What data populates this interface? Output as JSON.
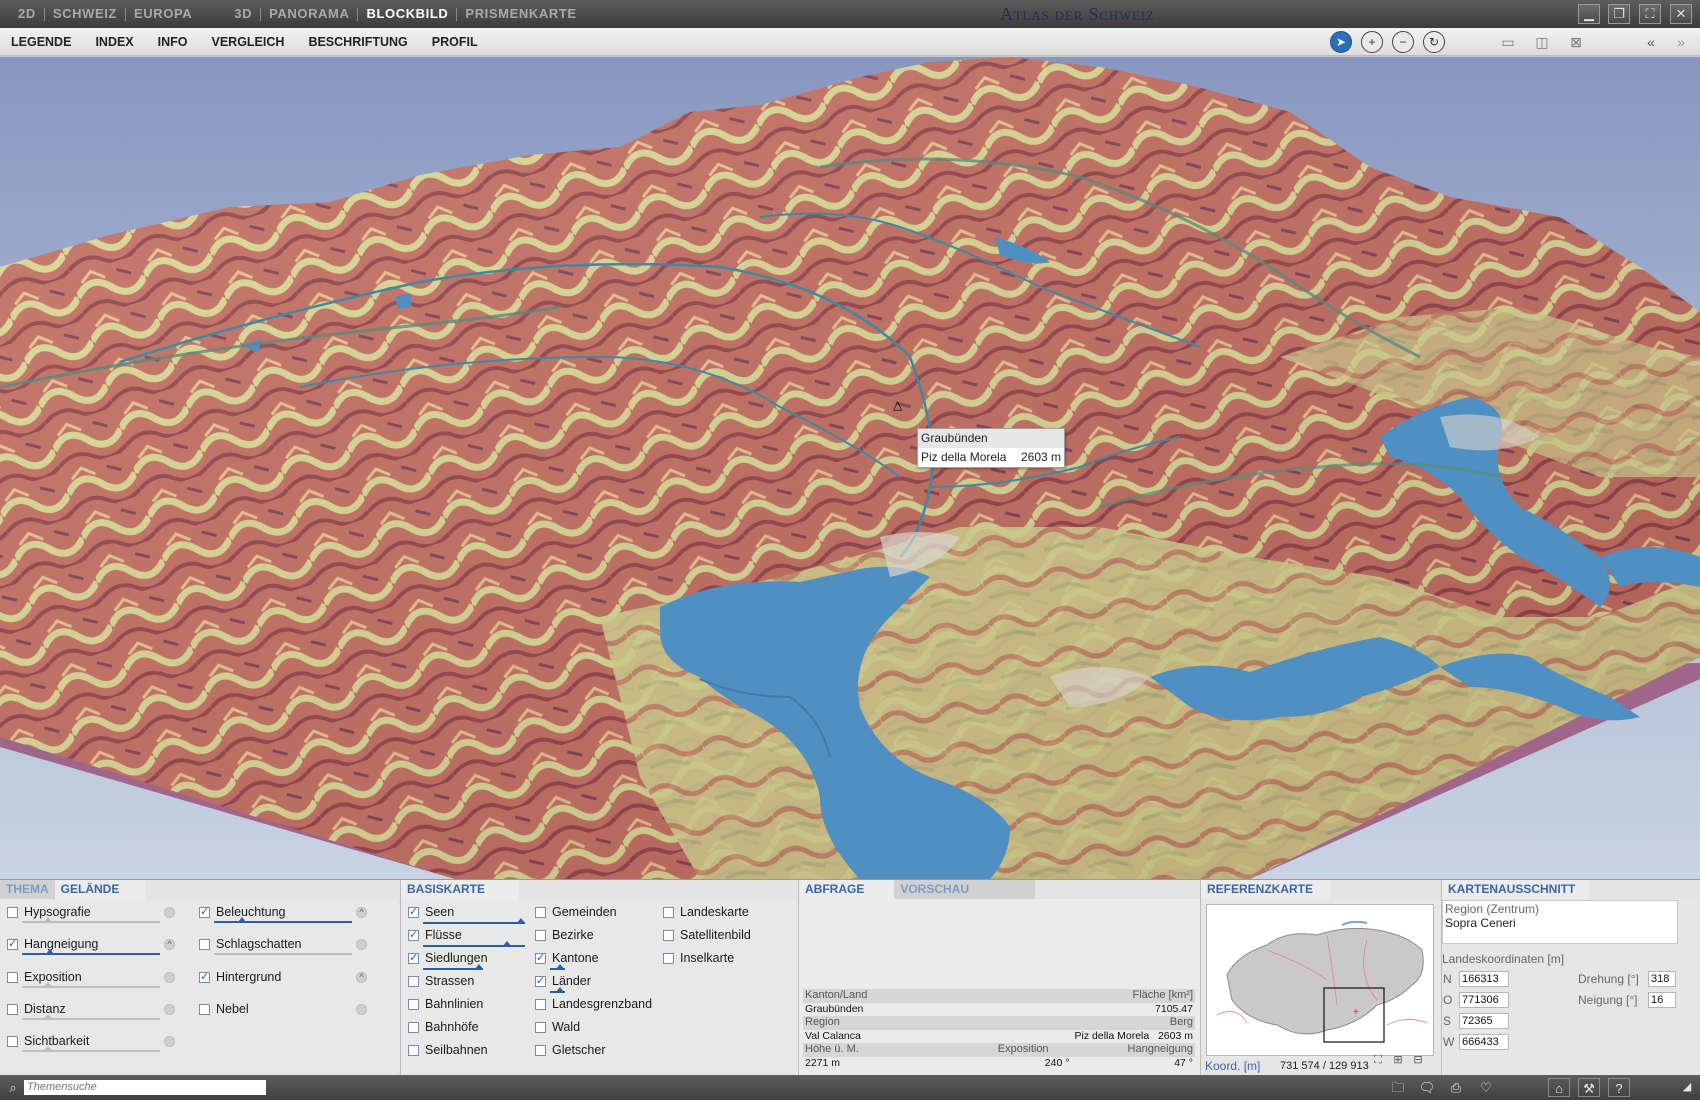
{
  "topbar": {
    "modes_2d": [
      "2D",
      "SCHWEIZ",
      "EUROPA"
    ],
    "modes_3d": [
      "3D",
      "PANORAMA",
      "BLOCKBILD",
      "PRISMENKARTE"
    ],
    "active_mode": "BLOCKBILD",
    "title": "Atlas der Schweiz",
    "window_controls": [
      "minimize-icon",
      "restore-icon",
      "fullscreen-icon",
      "close-icon"
    ]
  },
  "menu": {
    "items": [
      "LEGENDE",
      "INDEX",
      "INFO",
      "VERGLEICH",
      "BESCHRIFTUNG",
      "PROFIL"
    ],
    "tools": [
      "select-arrow-icon",
      "zoom-in-icon",
      "zoom-out-icon",
      "rotate-icon"
    ],
    "view_tools": [
      "horizontal-split-icon",
      "vertical-split-icon",
      "no-split-icon"
    ],
    "nav_tools": [
      "collapse-left-icon",
      "collapse-right-icon"
    ]
  },
  "map": {
    "tooltip": {
      "region": "Graubünden",
      "peak": "Piz della Morela",
      "height": "2603 m"
    },
    "summit_marker": "△"
  },
  "panel": {
    "tabs_left": [
      "THEMA",
      "GELÄNDE"
    ],
    "active_left_tab": "GELÄNDE",
    "gelaende_col1": [
      {
        "label": "Hypsografie",
        "checked": false
      },
      {
        "label": "Hangneigung",
        "checked": true
      },
      {
        "label": "Exposition",
        "checked": false
      },
      {
        "label": "Distanz",
        "checked": false
      },
      {
        "label": "Sichtbarkeit",
        "checked": false
      }
    ],
    "gelaende_col2": [
      {
        "label": "Beleuchtung",
        "checked": true
      },
      {
        "label": "Schlagschatten",
        "checked": false
      },
      {
        "label": "Hintergrund",
        "checked": true
      },
      {
        "label": "Nebel",
        "checked": false
      }
    ],
    "basiskarte_title": "BASISKARTE",
    "basis_col1": [
      {
        "label": "Seen",
        "checked": true
      },
      {
        "label": "Flüsse",
        "checked": true
      },
      {
        "label": "Siedlungen",
        "checked": true
      },
      {
        "label": "Strassen",
        "checked": false
      },
      {
        "label": "Bahnlinien",
        "checked": false
      },
      {
        "label": "Bahnhöfe",
        "checked": false
      },
      {
        "label": "Seilbahnen",
        "checked": false
      }
    ],
    "basis_col2": [
      {
        "label": "Gemeinden",
        "checked": false
      },
      {
        "label": "Bezirke",
        "checked": false
      },
      {
        "label": "Kantone",
        "checked": true
      },
      {
        "label": "Länder",
        "checked": true
      },
      {
        "label": "Landesgrenzband",
        "checked": false
      },
      {
        "label": "Wald",
        "checked": false
      },
      {
        "label": "Gletscher",
        "checked": false
      }
    ],
    "basis_col3": [
      {
        "label": "Landeskarte",
        "checked": false
      },
      {
        "label": "Satellitenbild",
        "checked": false
      },
      {
        "label": "Inselkarte",
        "checked": false
      }
    ],
    "abfrage_tabs": [
      "ABFRAGE",
      "VORSCHAU"
    ],
    "abfrage": {
      "h1": [
        "Kanton/Land",
        "Fläche [km²]"
      ],
      "v1": [
        "Graubünden",
        "7105.47"
      ],
      "h2": [
        "Region",
        "Berg"
      ],
      "v2": [
        "Val Calanca",
        "Piz della Morela   2603 m"
      ],
      "h3": [
        "Höhe ü. M.",
        "Exposition",
        "Hangneigung"
      ],
      "v3": [
        "2271 m",
        "240 °",
        "47 °"
      ]
    },
    "referenzkarte_title": "REFERENZKARTE",
    "koord_label": "Koord. [m]",
    "koord_value": "731 574 / 129 913",
    "kartenausschnitt_title": "KARTENAUSSCHNITT",
    "region_label": "Region (Zentrum)",
    "region_value": "Sopra Ceneri",
    "landeskoordinaten_label": "Landeskoordinaten [m]",
    "coords": [
      {
        "k": "N",
        "v": "166313"
      },
      {
        "k": "O",
        "v": "771306"
      },
      {
        "k": "S",
        "v": "72365"
      },
      {
        "k": "W",
        "v": "666433"
      }
    ],
    "drehung_label": "Drehung [°]",
    "drehung_value": "318",
    "neigung_label": "Neigung [°]",
    "neigung_value": "16"
  },
  "status": {
    "search_placeholder": "Themensuche",
    "icons": [
      "folder-icon",
      "comment-icon",
      "print-icon",
      "bookmark-icon",
      "home-icon",
      "tools-icon",
      "help-icon",
      "resize-icon"
    ]
  },
  "colors": {
    "accent": "#2a5fa8",
    "lake": "#4f8fc2",
    "terrain_steep": "#a2504a",
    "terrain_flat": "#d7d98a",
    "sky": "#8797c0"
  }
}
